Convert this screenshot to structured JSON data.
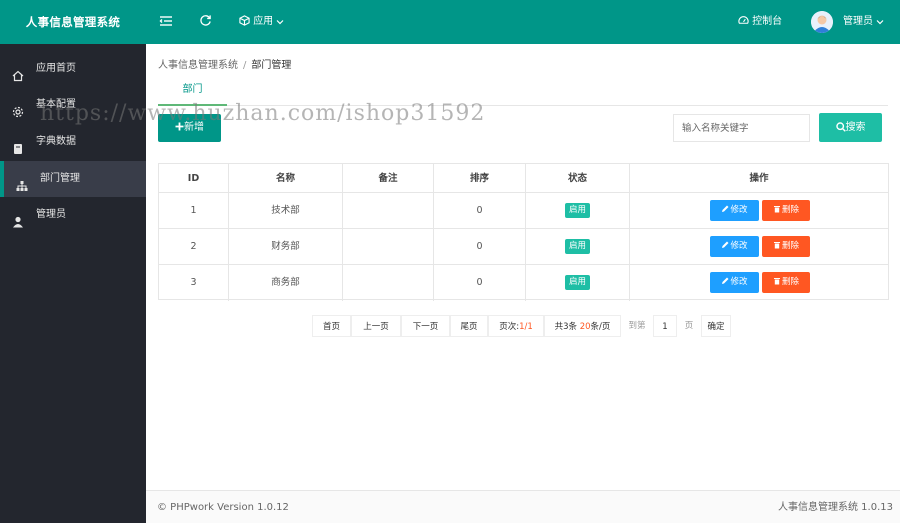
{
  "header": {
    "app_title": "人事信息管理系统",
    "apps_menu": "应用",
    "dashboard": "控制台",
    "user": "管理员"
  },
  "sidebar": {
    "items": [
      {
        "label": "应用首页",
        "icon": "home-icon"
      },
      {
        "label": "基本配置",
        "icon": "settings-icon"
      },
      {
        "label": "字典数据",
        "icon": "book-icon"
      },
      {
        "label": "部门管理",
        "icon": "sitemap-icon",
        "active": true
      },
      {
        "label": "管理员",
        "icon": "user-icon"
      }
    ]
  },
  "breadcrumb": {
    "root": "人事信息管理系统",
    "separator": "/",
    "current": "部门管理"
  },
  "tab": {
    "label": "部门"
  },
  "toolbar": {
    "add_label": "新增",
    "search_placeholder": "输入名称关键字",
    "search_label": "搜索"
  },
  "table": {
    "headers": [
      "ID",
      "名称",
      "备注",
      "排序",
      "状态",
      "操作"
    ],
    "rows": [
      {
        "id": "1",
        "name": "技术部",
        "note": "",
        "sort": "0",
        "status": "启用"
      },
      {
        "id": "2",
        "name": "财务部",
        "note": "",
        "sort": "0",
        "status": "启用"
      },
      {
        "id": "3",
        "name": "商务部",
        "note": "",
        "sort": "0",
        "status": "启用"
      }
    ],
    "edit_label": "修改",
    "delete_label": "删除"
  },
  "pager": {
    "first": "首页",
    "prev": "上一页",
    "next": "下一页",
    "last": "尾页",
    "page_prefix": "页次:",
    "page_value": "1/1",
    "total_prefix": "共3条 ",
    "per_page_value": "20",
    "per_page_suffix": "条/页",
    "goto": "到第",
    "page_input": "1",
    "page_unit": "页",
    "confirm": "确定"
  },
  "watermark": "https://www.huzhan.com/ishop31592",
  "footer": {
    "left": "© PHPwork Version 1.0.12",
    "right": "人事信息管理系统 1.0.13"
  },
  "colors": {
    "primary": "#009688",
    "sidebar_bg": "#23262e",
    "sidebar_active": "#393d49",
    "edit_button": "#1e9fff",
    "delete_button": "#ff5722",
    "status_badge": "#1ebea5"
  }
}
